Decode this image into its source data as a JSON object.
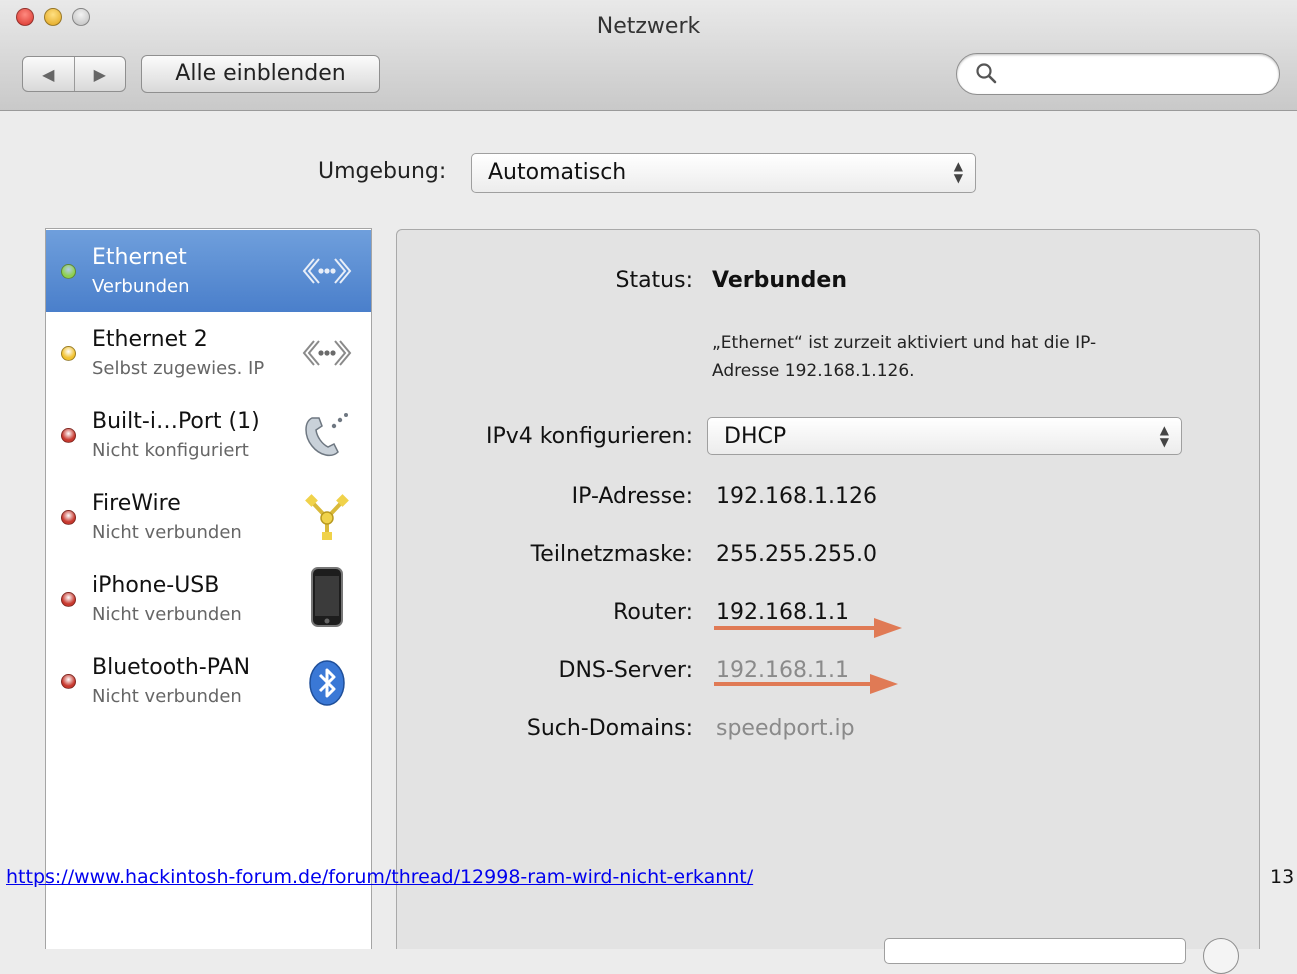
{
  "window": {
    "title": "Netzwerk"
  },
  "toolbar": {
    "back_glyph": "◀",
    "forward_glyph": "▶",
    "show_all_label": "Alle einblenden",
    "search_value": "",
    "search_icon": "search-icon"
  },
  "location": {
    "label": "Umgebung:",
    "value": "Automatisch"
  },
  "services": [
    {
      "name": "Ethernet",
      "status": "Verbunden",
      "state_color": "#8fd14f",
      "icon": "ethernet-icon",
      "selected": true
    },
    {
      "name": "Ethernet 2",
      "status": "Selbst zugewies. IP",
      "state_color": "#f2c230",
      "icon": "ethernet-icon",
      "selected": false
    },
    {
      "name": "Built-i…Port (1)",
      "status": "Nicht konfiguriert",
      "state_color": "#c8392f",
      "icon": "phone-modem-icon",
      "selected": false
    },
    {
      "name": "FireWire",
      "status": "Nicht verbunden",
      "state_color": "#c8392f",
      "icon": "firewire-icon",
      "selected": false
    },
    {
      "name": "iPhone-USB",
      "status": "Nicht verbunden",
      "state_color": "#c8392f",
      "icon": "iphone-icon",
      "selected": false
    },
    {
      "name": "Bluetooth-PAN",
      "status": "Nicht verbunden",
      "state_color": "#c8392f",
      "icon": "bluetooth-icon",
      "selected": false
    }
  ],
  "details": {
    "status_label": "Status:",
    "status_value": "Verbunden",
    "description_line1": "„Ethernet“ ist zurzeit aktiviert und hat die IP-",
    "description_line2": "Adresse 192.168.1.126.",
    "configure_label": "IPv4 konfigurieren:",
    "configure_value": "DHCP",
    "ip_label": "IP-Adresse:",
    "ip_value": "192.168.1.126",
    "subnet_label": "Teilnetzmaske:",
    "subnet_value": "255.255.255.0",
    "router_label": "Router:",
    "router_value": "192.168.1.1",
    "dns_label": "DNS-Server:",
    "dns_value": "192.168.1.1",
    "search_domains_label": "Such-Domains:",
    "search_domains_value": "speedport.ip"
  },
  "annotations": {
    "arrow_color": "#e07a55"
  },
  "footer": {
    "link": "https://www.hackintosh-forum.de/forum/thread/12998-ram-wird-nicht-erkannt/",
    "page_number": "13"
  }
}
